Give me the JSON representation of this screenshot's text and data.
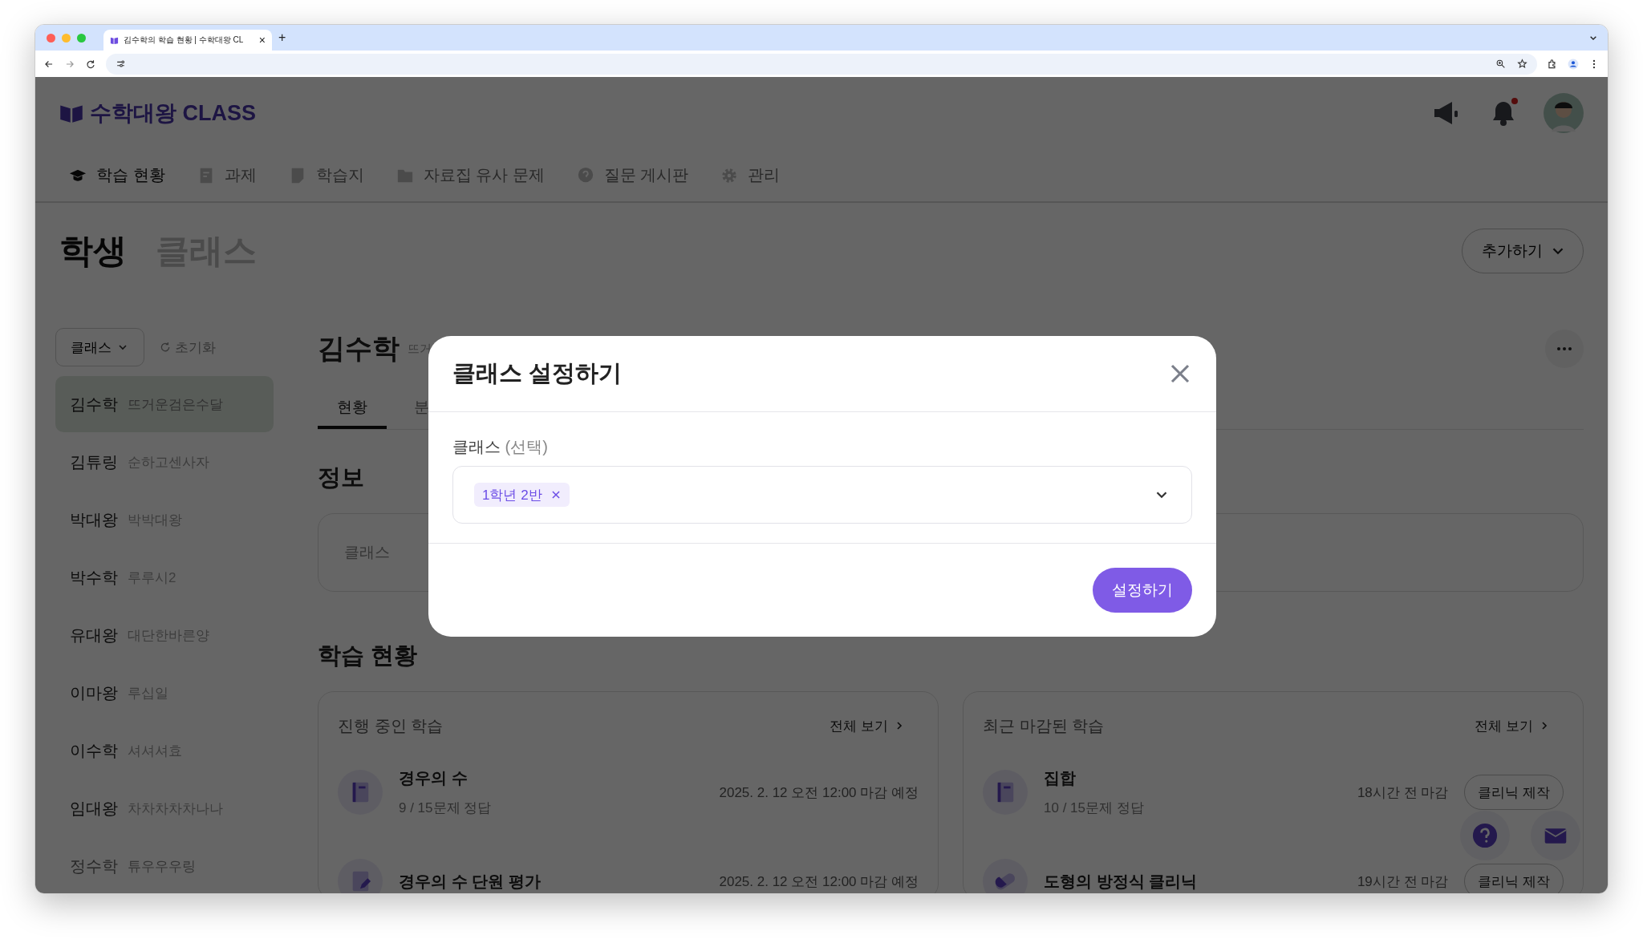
{
  "browser": {
    "tab_title": "김수학의 학습 현황 | 수학대왕 CL",
    "tab_close": "×",
    "new_tab": "+"
  },
  "header": {
    "logo": "수학대왕 CLASS",
    "notification_unread": true
  },
  "nav": [
    {
      "label": "학습 현황",
      "kind": "cap",
      "selected": true
    },
    {
      "label": "과제",
      "kind": "doc",
      "selected": false
    },
    {
      "label": "학습지",
      "kind": "note",
      "selected": false
    },
    {
      "label": "자료집 유사 문제",
      "kind": "folder",
      "selected": false
    },
    {
      "label": "질문 게시판",
      "kind": "question",
      "selected": false
    },
    {
      "label": "관리",
      "kind": "gear",
      "selected": false
    }
  ],
  "page_tabs": [
    {
      "label": "학생",
      "selected": true
    },
    {
      "label": "클래스",
      "selected": false
    }
  ],
  "add_button": "추가하기",
  "sidebar": {
    "filter": "클래스",
    "reset": "초기화",
    "students": [
      {
        "name": "김수학",
        "nickname": "뜨거운검은수달",
        "selected": true
      },
      {
        "name": "김튜링",
        "nickname": "순하고센사자",
        "selected": false
      },
      {
        "name": "박대왕",
        "nickname": "박박대왕",
        "selected": false
      },
      {
        "name": "박수학",
        "nickname": "루루시2",
        "selected": false
      },
      {
        "name": "유대왕",
        "nickname": "대단한바른양",
        "selected": false
      },
      {
        "name": "이마왕",
        "nickname": "루십일",
        "selected": false
      },
      {
        "name": "이수학",
        "nickname": "셔셔셔효",
        "selected": false
      },
      {
        "name": "임대왕",
        "nickname": "차차차차차나나",
        "selected": false
      },
      {
        "name": "정수학",
        "nickname": "튜우우우링",
        "selected": false
      }
    ]
  },
  "student": {
    "name": "김수학",
    "nickname": "뜨거",
    "tabs": [
      {
        "label": "현황",
        "selected": true
      },
      {
        "label": "분",
        "selected": false
      }
    ],
    "info_title": "정보",
    "info_label": "클래스",
    "progress_title": "학습 현황",
    "cards": [
      {
        "title": "진행 중인 학습",
        "link": "전체 보기",
        "items": [
          {
            "kind": "book",
            "title": "경우의 수",
            "subtitle": "9 / 15문제 정답",
            "meta": "2025. 2. 12 오전 12:00 마감 예정"
          },
          {
            "kind": "pencil",
            "title": "경우의 수 단원 평가",
            "meta": "2025. 2. 12 오전 12:00 마감 예정"
          }
        ]
      },
      {
        "title": "최근 마감된 학습",
        "link": "전체 보기",
        "items": [
          {
            "kind": "book",
            "title": "집합",
            "subtitle": "10 / 15문제 정답",
            "meta": "18시간 전 마감",
            "action": "클리닉 제작"
          },
          {
            "kind": "pill",
            "title": "도형의 방정식 클리닉",
            "meta": "19시간 전 마감",
            "action": "클리닉 제작"
          }
        ]
      }
    ]
  },
  "modal": {
    "title": "클래스 설정하기",
    "label": "클래스",
    "hint": "(선택)",
    "tags": [
      "1학년 2반"
    ],
    "submit": "설정하기"
  }
}
